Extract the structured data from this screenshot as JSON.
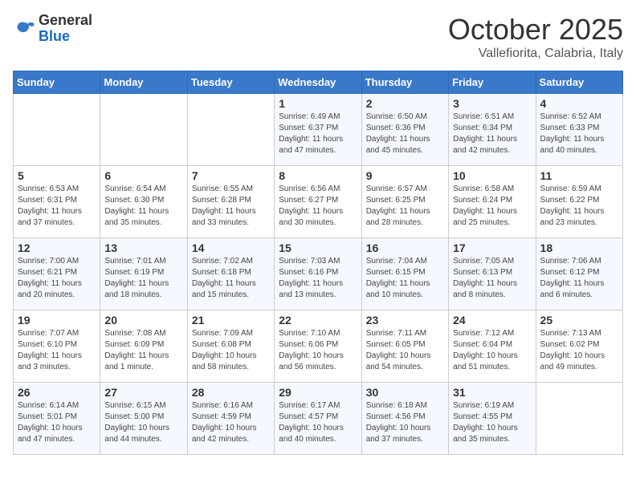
{
  "logo": {
    "general": "General",
    "blue": "Blue"
  },
  "title": "October 2025",
  "subtitle": "Vallefiorita, Calabria, Italy",
  "headers": [
    "Sunday",
    "Monday",
    "Tuesday",
    "Wednesday",
    "Thursday",
    "Friday",
    "Saturday"
  ],
  "weeks": [
    [
      {
        "day": "",
        "info": ""
      },
      {
        "day": "",
        "info": ""
      },
      {
        "day": "",
        "info": ""
      },
      {
        "day": "1",
        "info": "Sunrise: 6:49 AM\nSunset: 6:37 PM\nDaylight: 11 hours\nand 47 minutes."
      },
      {
        "day": "2",
        "info": "Sunrise: 6:50 AM\nSunset: 6:36 PM\nDaylight: 11 hours\nand 45 minutes."
      },
      {
        "day": "3",
        "info": "Sunrise: 6:51 AM\nSunset: 6:34 PM\nDaylight: 11 hours\nand 42 minutes."
      },
      {
        "day": "4",
        "info": "Sunrise: 6:52 AM\nSunset: 6:33 PM\nDaylight: 11 hours\nand 40 minutes."
      }
    ],
    [
      {
        "day": "5",
        "info": "Sunrise: 6:53 AM\nSunset: 6:31 PM\nDaylight: 11 hours\nand 37 minutes."
      },
      {
        "day": "6",
        "info": "Sunrise: 6:54 AM\nSunset: 6:30 PM\nDaylight: 11 hours\nand 35 minutes."
      },
      {
        "day": "7",
        "info": "Sunrise: 6:55 AM\nSunset: 6:28 PM\nDaylight: 11 hours\nand 33 minutes."
      },
      {
        "day": "8",
        "info": "Sunrise: 6:56 AM\nSunset: 6:27 PM\nDaylight: 11 hours\nand 30 minutes."
      },
      {
        "day": "9",
        "info": "Sunrise: 6:57 AM\nSunset: 6:25 PM\nDaylight: 11 hours\nand 28 minutes."
      },
      {
        "day": "10",
        "info": "Sunrise: 6:58 AM\nSunset: 6:24 PM\nDaylight: 11 hours\nand 25 minutes."
      },
      {
        "day": "11",
        "info": "Sunrise: 6:59 AM\nSunset: 6:22 PM\nDaylight: 11 hours\nand 23 minutes."
      }
    ],
    [
      {
        "day": "12",
        "info": "Sunrise: 7:00 AM\nSunset: 6:21 PM\nDaylight: 11 hours\nand 20 minutes."
      },
      {
        "day": "13",
        "info": "Sunrise: 7:01 AM\nSunset: 6:19 PM\nDaylight: 11 hours\nand 18 minutes."
      },
      {
        "day": "14",
        "info": "Sunrise: 7:02 AM\nSunset: 6:18 PM\nDaylight: 11 hours\nand 15 minutes."
      },
      {
        "day": "15",
        "info": "Sunrise: 7:03 AM\nSunset: 6:16 PM\nDaylight: 11 hours\nand 13 minutes."
      },
      {
        "day": "16",
        "info": "Sunrise: 7:04 AM\nSunset: 6:15 PM\nDaylight: 11 hours\nand 10 minutes."
      },
      {
        "day": "17",
        "info": "Sunrise: 7:05 AM\nSunset: 6:13 PM\nDaylight: 11 hours\nand 8 minutes."
      },
      {
        "day": "18",
        "info": "Sunrise: 7:06 AM\nSunset: 6:12 PM\nDaylight: 11 hours\nand 6 minutes."
      }
    ],
    [
      {
        "day": "19",
        "info": "Sunrise: 7:07 AM\nSunset: 6:10 PM\nDaylight: 11 hours\nand 3 minutes."
      },
      {
        "day": "20",
        "info": "Sunrise: 7:08 AM\nSunset: 6:09 PM\nDaylight: 11 hours\nand 1 minute."
      },
      {
        "day": "21",
        "info": "Sunrise: 7:09 AM\nSunset: 6:08 PM\nDaylight: 10 hours\nand 58 minutes."
      },
      {
        "day": "22",
        "info": "Sunrise: 7:10 AM\nSunset: 6:06 PM\nDaylight: 10 hours\nand 56 minutes."
      },
      {
        "day": "23",
        "info": "Sunrise: 7:11 AM\nSunset: 6:05 PM\nDaylight: 10 hours\nand 54 minutes."
      },
      {
        "day": "24",
        "info": "Sunrise: 7:12 AM\nSunset: 6:04 PM\nDaylight: 10 hours\nand 51 minutes."
      },
      {
        "day": "25",
        "info": "Sunrise: 7:13 AM\nSunset: 6:02 PM\nDaylight: 10 hours\nand 49 minutes."
      }
    ],
    [
      {
        "day": "26",
        "info": "Sunrise: 6:14 AM\nSunset: 5:01 PM\nDaylight: 10 hours\nand 47 minutes."
      },
      {
        "day": "27",
        "info": "Sunrise: 6:15 AM\nSunset: 5:00 PM\nDaylight: 10 hours\nand 44 minutes."
      },
      {
        "day": "28",
        "info": "Sunrise: 6:16 AM\nSunset: 4:59 PM\nDaylight: 10 hours\nand 42 minutes."
      },
      {
        "day": "29",
        "info": "Sunrise: 6:17 AM\nSunset: 4:57 PM\nDaylight: 10 hours\nand 40 minutes."
      },
      {
        "day": "30",
        "info": "Sunrise: 6:18 AM\nSunset: 4:56 PM\nDaylight: 10 hours\nand 37 minutes."
      },
      {
        "day": "31",
        "info": "Sunrise: 6:19 AM\nSunset: 4:55 PM\nDaylight: 10 hours\nand 35 minutes."
      },
      {
        "day": "",
        "info": ""
      }
    ]
  ]
}
